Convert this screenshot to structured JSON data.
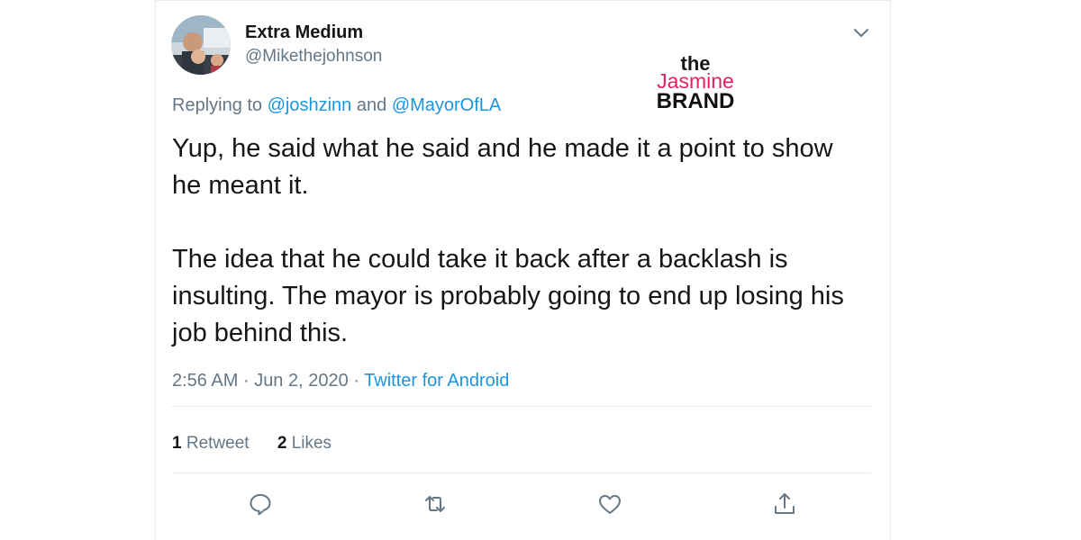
{
  "colors": {
    "text_primary": "#14171a",
    "text_secondary": "#657786",
    "link": "#1b95e0",
    "divider": "#e6ecf0",
    "logo_accent": "#e91e63"
  },
  "author": {
    "display_name": "Extra Medium",
    "handle": "@Mikethejohnson",
    "avatar_icon": "avatar-photo"
  },
  "logo": {
    "line1": "the",
    "line2": "Jasmine",
    "line3": "BRAND"
  },
  "reply": {
    "prefix": "Replying to",
    "mention1": "@joshzinn",
    "conjunction": "and",
    "mention2": "@MayorOfLA"
  },
  "tweet": {
    "paragraph1": "Yup, he said what he said and he made it a point to show he meant it.",
    "paragraph2": "The idea that he could take it back after a backlash is insulting. The mayor is probably going to end up losing his job behind this."
  },
  "meta": {
    "time": "2:56 AM",
    "separator": "·",
    "date": "Jun 2, 2020",
    "source": "Twitter for Android"
  },
  "stats": {
    "retweets_count": "1",
    "retweets_label": "Retweet",
    "likes_count": "2",
    "likes_label": "Likes"
  },
  "actions": [
    "reply-icon",
    "retweet-icon",
    "like-icon",
    "share-icon"
  ]
}
